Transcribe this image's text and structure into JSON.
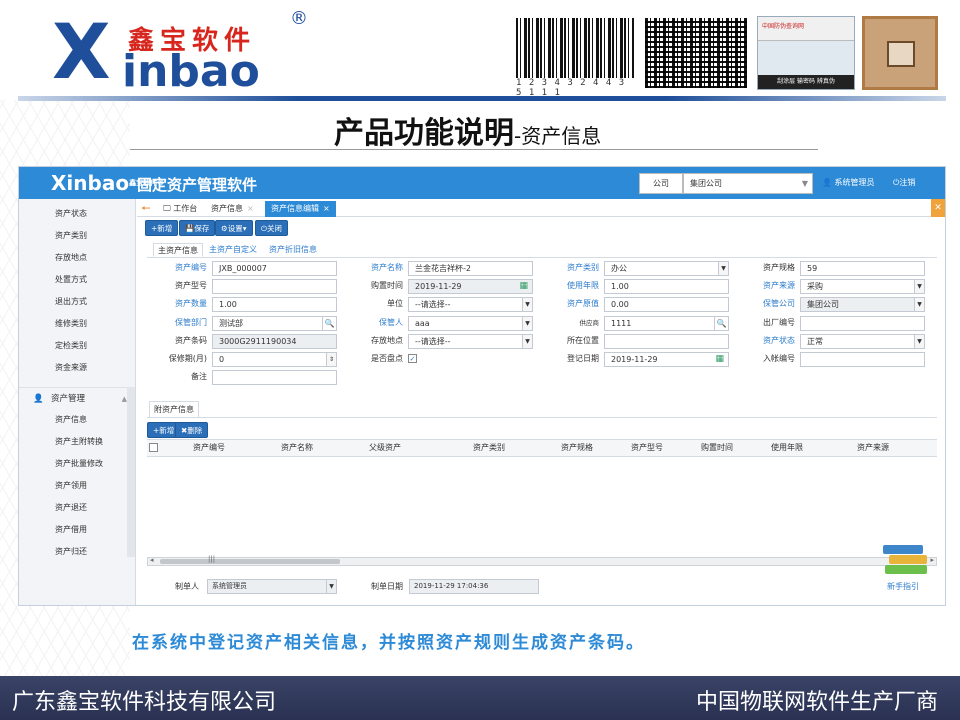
{
  "header": {
    "logo_x": "X",
    "logo_cn": "鑫宝软件",
    "logo_en": "inbao",
    "logo_reg": "®",
    "barcode_number": "1 2 3 4 3 2 4 4 3 5 1 1 1",
    "antifake_label": "中国防伪查询网",
    "antifake_footer": "刮涂层  输密码  辨真伪"
  },
  "slide": {
    "title": "产品功能说明",
    "subtitle": "-资产信息",
    "description": "在系统中登记资产相关信息，并按照资产规则生成资产条码。",
    "footer_left": "广东鑫宝软件科技有限公司",
    "footer_right": "中国物联网软件生产厂商"
  },
  "app": {
    "mini_logo_main": "Xinbao",
    "mini_logo_small": "鑫宝软件®",
    "title": "固定资产管理软件",
    "company_label": "公司",
    "company_value": "集团公司",
    "admin_label": "系统管理员",
    "logout_label": "注销"
  },
  "sidebar": {
    "items_top": [
      "资产状态",
      "资产类别",
      "存放地点",
      "处置方式",
      "退出方式",
      "维修类别",
      "定检类别",
      "资金来源"
    ],
    "group_label": "资产管理",
    "items_group": [
      "资产信息",
      "资产主附转换",
      "资产批量修改",
      "资产领用",
      "资产退还",
      "资产借用",
      "资产归还"
    ]
  },
  "tabs": {
    "home": "工作台",
    "info": "资产信息",
    "edit": "资产信息编辑"
  },
  "toolbar": {
    "add": "+新增",
    "save": "保存",
    "settings": "设置",
    "close": "关闭"
  },
  "subtabs": [
    "主资产信息",
    "主资产自定义",
    "资产折旧信息"
  ],
  "form": {
    "asset_no_label": "资产编号",
    "asset_no": "JXB_000007",
    "asset_name_label": "资产名称",
    "asset_name": "兰金花吉祥杯-2",
    "asset_type_label": "资产类别",
    "asset_type": "办公",
    "asset_spec_label": "资产规格",
    "asset_spec": "59",
    "model_label": "资产型号",
    "model": "",
    "buy_date_label": "购置时间",
    "buy_date": "2019-11-29",
    "years_label": "使用年限",
    "years": "1.00",
    "source_label": "资产来源",
    "source": "采购",
    "qty_label": "资产数量",
    "qty": "1.00",
    "unit_label": "单位",
    "unit": "--请选择--",
    "orig_label": "资产原值",
    "orig": "0.00",
    "keep_co_label": "保管公司",
    "keep_co": "集团公司",
    "keep_dept_label": "保管部门",
    "keep_dept": "测试部",
    "keeper_label": "保管人",
    "keeper": "aaa",
    "supplier_label": "供应商",
    "supplier": "1111",
    "factory_no_label": "出厂编号",
    "factory_no": "",
    "barcode_label": "资产条码",
    "barcode": "3000G2911190034",
    "place_label": "存放地点",
    "place": "--请选择--",
    "location_label": "所在位置",
    "location": "",
    "status_label": "资产状态",
    "status": "正常",
    "warranty_label": "保修期(月)",
    "warranty": "0",
    "checked_label": "是否盘点",
    "checked_mark": "✓",
    "reg_date_label": "登记日期",
    "reg_date": "2019-11-29",
    "account_no_label": "入帐编号",
    "account_no": "",
    "remark_label": "备注",
    "remark": ""
  },
  "attached": {
    "panel_tab": "附资产信息",
    "add": "+新增",
    "delete": "✖删除",
    "columns": [
      "资产编号",
      "资产名称",
      "父级资产",
      "资产类别",
      "资产规格",
      "资产型号",
      "购置时间",
      "使用年限",
      "资产来源"
    ]
  },
  "footer": {
    "maker_label": "制单人",
    "maker": "系统管理员",
    "make_date_label": "制单日期",
    "make_date": "2019-11-29 17:04:36",
    "guide": "新手指引"
  }
}
